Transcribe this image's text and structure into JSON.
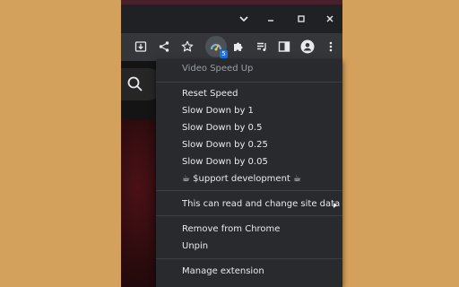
{
  "menu": {
    "title": "Video Speed Up",
    "items": [
      {
        "label": "Reset Speed"
      },
      {
        "label": "Slow Down by 1"
      },
      {
        "label": "Slow Down by 0.5"
      },
      {
        "label": "Slow Down by 0.25"
      },
      {
        "label": "Slow Down by 0.05"
      },
      {
        "label": "☕ $upport development ☕"
      }
    ],
    "site_data": "This can read and change site data",
    "remove": "Remove from Chrome",
    "unpin": "Unpin",
    "manage": "Manage extension"
  },
  "toolbar": {
    "extension_badge": "5",
    "icons": [
      "install-icon",
      "share-icon",
      "star-icon",
      "video-speed-extension-icon",
      "puzzle-icon",
      "reading-list-icon",
      "side-panel-icon",
      "profile-icon",
      "more-icon"
    ]
  },
  "window_controls": [
    "chevron-down-icon",
    "minimize-icon",
    "maximize-icon",
    "close-icon"
  ],
  "colors": {
    "desktop": "#d4a15c",
    "menu_bg": "#292a2d",
    "toolbar_bg": "#35363a",
    "badge": "#1a73e8"
  }
}
